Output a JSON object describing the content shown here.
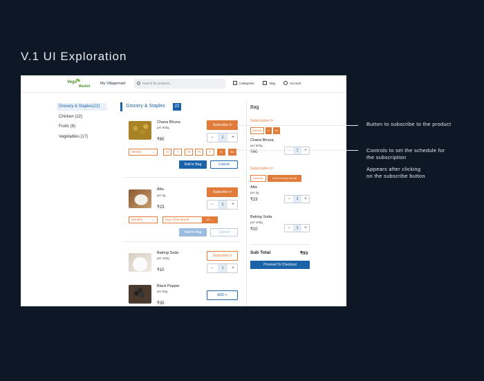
{
  "heading": "V.1 UI Exploration",
  "header": {
    "logo_line1": "Vega",
    "logo_line2": "Basket",
    "store_name": "My Villagemart",
    "search_placeholder": "Search for products...",
    "categories": "Categories",
    "bag": "Bag",
    "account": "Account"
  },
  "sidebar": {
    "items": [
      {
        "label": "Grocery & Staples(22)"
      },
      {
        "label": "Chicken (12)"
      },
      {
        "label": "Fruits (8)"
      },
      {
        "label": "Vegetables (17)"
      }
    ]
  },
  "main": {
    "title": "Grocery & Staples",
    "count": "22",
    "products": [
      {
        "name": "Chana Bhuna",
        "unit": "per 500g",
        "price": "₹60",
        "subscribe": "Subscribe",
        "qty": "1",
        "frequency": "Weekly",
        "days": [
          "M",
          "T",
          "W",
          "Th",
          "F",
          "S",
          "Su"
        ],
        "add_to_bag": "Add to Bag",
        "cancel": "Cancel"
      },
      {
        "name": "Atta",
        "unit": "per kg",
        "price": "₹23",
        "subscribe": "Subscribe",
        "qty": "1",
        "frequency": "Monthly",
        "day_of_month_label": "Day of the Month",
        "day_of_month": "21",
        "add_to_bag": "Add to Bag",
        "cancel": "Cancel"
      },
      {
        "name": "Baking Soda",
        "unit": "per 100g",
        "price": "₹10",
        "subscribe": "Subscribe",
        "qty": "1"
      },
      {
        "name": "Black Pepper",
        "unit": "per 50g",
        "price": "₹35",
        "add": "ADD"
      }
    ]
  },
  "bag": {
    "title": "Bag",
    "items": [
      {
        "sub_label": "Subscription",
        "chips": [
          "Weekly",
          "S",
          "Su"
        ],
        "name": "Chana Bhuna",
        "unit": "per 500g",
        "price": "₹60",
        "qty": "1"
      },
      {
        "sub_label": "Subscription",
        "chips": [
          "Monthly",
          "21st of every month"
        ],
        "name": "Atta",
        "unit": "per kg",
        "price": "₹23",
        "qty": "1"
      },
      {
        "name": "Baking Soda",
        "unit": "per 100g",
        "price": "₹10",
        "qty": "1"
      }
    ],
    "subtotal_label": "Sub Total",
    "subtotal_value": "₹93",
    "checkout": "Proceed To Checkout"
  },
  "annotations": {
    "a1": "Button to subscribe to the product",
    "a2_line1": "Controls to set the schedule for",
    "a2_line2": "the subscription",
    "a3_line1": "Appears after clicking",
    "a3_line2": "on the subscribe button"
  },
  "colors": {
    "accent": "#e07b39",
    "primary": "#1b62a8",
    "background": "#0e1726"
  }
}
